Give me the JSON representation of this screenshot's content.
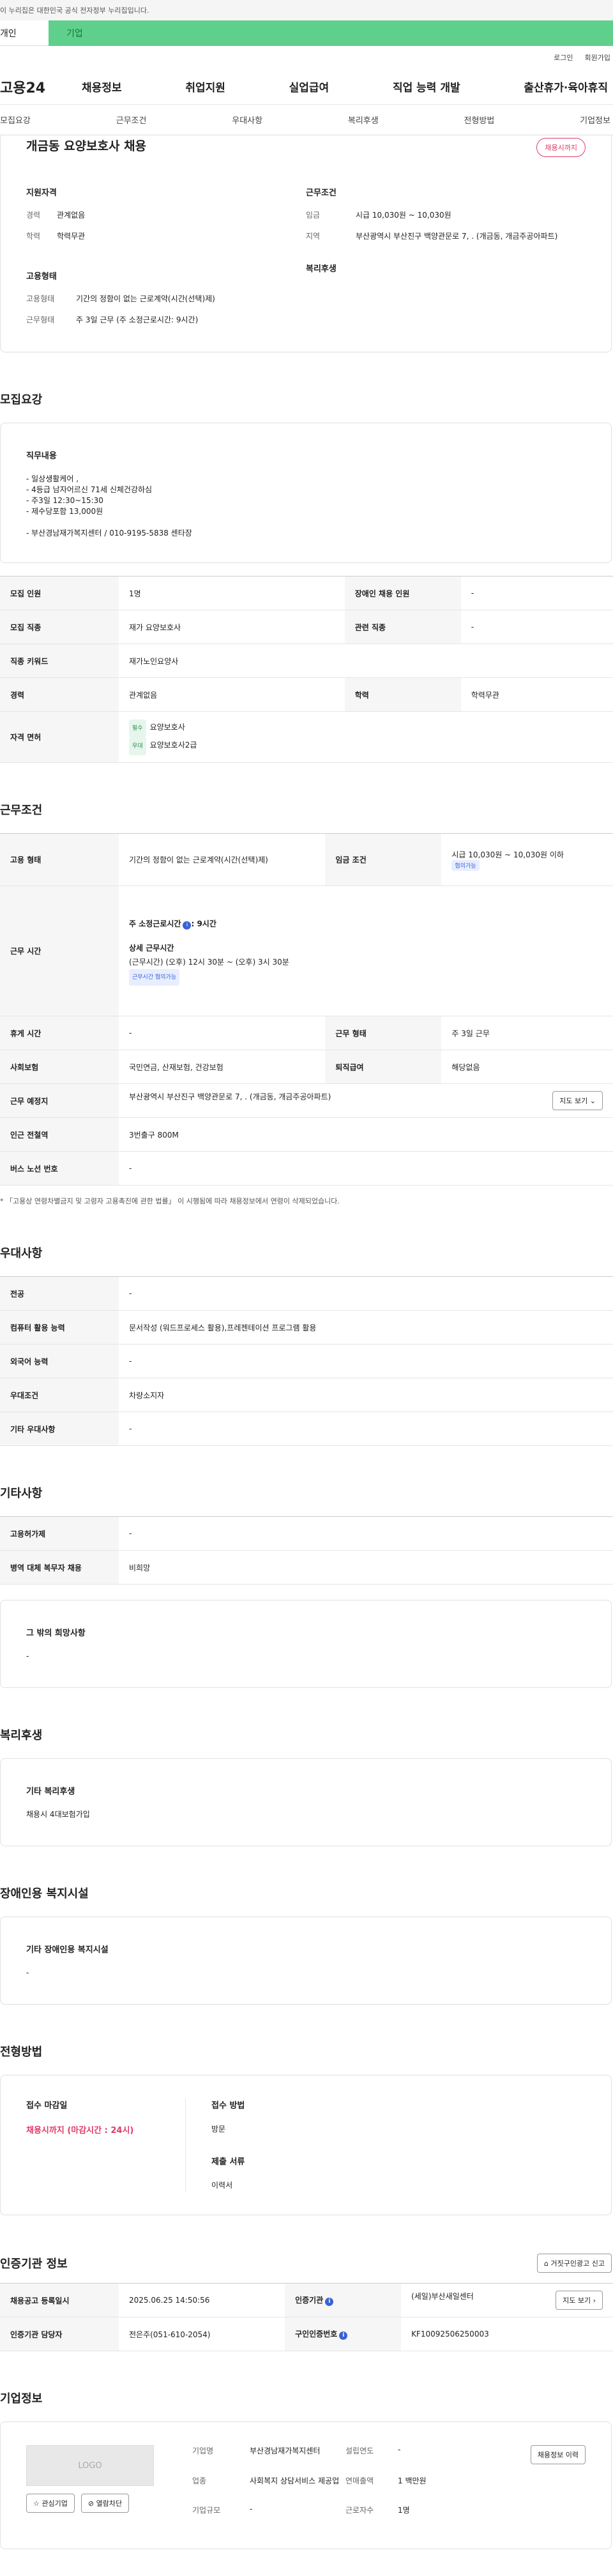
{
  "banner": "이 누리집은 대한민국 공식 전자정부 누리집입니다.",
  "user_tabs": [
    "개인",
    "기업"
  ],
  "util": [
    "로그인",
    "회원가입"
  ],
  "gnb": {
    "logo": "고용24",
    "menu": [
      "채용정보",
      "취업지원",
      "실업급여",
      "직업 능력 개발",
      "출산휴가·육아휴직"
    ]
  },
  "anchor": [
    "모집요강",
    "근무조건",
    "우대사항",
    "복리후생",
    "전형방법",
    "기업정보"
  ],
  "summary": {
    "title": "개금동 요양보호사 채용",
    "badge": "채용시까지",
    "qual_title": "지원자격",
    "qual": [
      {
        "k": "경력",
        "v": "관계없음"
      },
      {
        "k": "학력",
        "v": "학력무관"
      }
    ],
    "cond_title": "근무조건",
    "cond": [
      {
        "k": "임금",
        "v": "시급 10,030원 ~ 10,030원"
      },
      {
        "k": "지역",
        "v": "부산광역시 부산진구 백양관문로 7, . (개금동, 개금주공아파트)"
      }
    ],
    "emp_title": "고용형태",
    "emp": [
      {
        "k": "고용형태",
        "v": "기간의 정함이 없는 근로계약(시간(선택)제)"
      },
      {
        "k": "근무형태",
        "v": "주 3일 근무 (주 소정근로시간: 9시간)"
      }
    ],
    "welfare_title": "복리후생"
  },
  "recruit": {
    "title": "모집요강",
    "job_title": "직무내용",
    "job_desc": "- 일상생활케어 ,\n- 4등급 남자어르신 71세 신체건강하심\n- 주3일 12:30~15:30\n- 제수당포함 13,000원\n\n- 부산경남재가복지센터 / 010-9195-5838 센타장",
    "rows": {
      "count_k": "모집 인원",
      "count_v": "1명",
      "disab_k": "장애인 채용 인원",
      "disab_v": "-",
      "job_k": "모집 직종",
      "job_v": "재가 요양보호사",
      "rel_k": "관련 직종",
      "rel_v": "-",
      "kw_k": "직종 키워드",
      "kw_v": "재가노인요양사",
      "exp_k": "경력",
      "exp_v": "관계없음",
      "edu_k": "학력",
      "edu_v": "학력무관",
      "lic_k": "자격 면허",
      "lic_tag1": "필수",
      "lic_v1": "요양보호사",
      "lic_tag2": "우대",
      "lic_v2": "요양보호사2급"
    }
  },
  "work": {
    "title": "근무조건",
    "emp_k": "고용 형태",
    "emp_v": "기간의 정함이 없는 근로계약(시간(선택)제)",
    "wage_k": "임금 조건",
    "wage_v": "시급 10,030원 ~ 10,030원 이하",
    "wage_tag": "협의가능",
    "time_k": "근무 시간",
    "time_week": "주 소정근로시간",
    "time_week_v": ": 9시간",
    "time_detail_title": "상세 근무시간",
    "time_detail": "(근무시간) (오후) 12시 30분 ~ (오후) 3시 30분",
    "time_tag": "근무시간 협의가능",
    "rest_k": "휴게 시간",
    "rest_v": "-",
    "form_k": "근무 형태",
    "form_v": "주 3일 근무",
    "ins_k": "사회보험",
    "ins_v": "국민연금, 산재보험, 건강보험",
    "sev_k": "퇴직급여",
    "sev_v": "해당없음",
    "loc_k": "근무 예정지",
    "loc_v": "부산광역시 부산진구 백양관문로 7, . (개금동, 개금주공아파트)",
    "map_btn": "지도 보기",
    "sub_k": "인근 전철역",
    "sub_v": "3번출구 800M",
    "bus_k": "버스 노선 번호",
    "bus_v": "-",
    "note": "* 「고용상 연령차별금지 및 고령자 고용촉진에 관한 법률」 이 시행됨에 따라 채용정보에서 연령이 삭제되었습니다."
  },
  "pref": {
    "title": "우대사항",
    "rows": [
      {
        "k": "전공",
        "v": "-"
      },
      {
        "k": "컴퓨터 활용 능력",
        "v": "문서작성 (워드프로세스 활용),프레젠테이션 프로그램 활용"
      },
      {
        "k": "외국어 능력",
        "v": "-"
      },
      {
        "k": "우대조건",
        "v": "차량소지자"
      },
      {
        "k": "기타 우대사항",
        "v": "-"
      }
    ]
  },
  "etc": {
    "title": "기타사항",
    "rows": [
      {
        "k": "고용허가제",
        "v": "-"
      },
      {
        "k": "병역 대체 복무자 채용",
        "v": "비희망"
      }
    ],
    "other_title": "그 밖의 희망사항",
    "other_v": "-"
  },
  "welfare": {
    "title": "복리후생",
    "box_title": "기타 복리후생",
    "box_v": "채용시 4대보험가입"
  },
  "disab": {
    "title": "장애인용 복지시설",
    "box_title": "기타 장애인용 복지시설",
    "box_v": "-"
  },
  "apply": {
    "title": "전형방법",
    "deadline_k": "접수 마감일",
    "deadline_v": "채용시까지 (마감시간 : 24시)",
    "method_k": "접수 방법",
    "method_v": "방문",
    "docs_k": "제출 서류",
    "docs_v": "이력서"
  },
  "cert": {
    "title": "인증기관 정보",
    "report_btn": "거짓구인광고 신고",
    "reg_k": "채용공고 등록일시",
    "reg_v": "2025.06.25 14:50:56",
    "org_k": "인증기관",
    "org_v": "(세일)부산새일센터",
    "map_btn": "지도 보기",
    "mgr_k": "인증기관 담당자",
    "mgr_v": "전은주(051-610-2054)",
    "num_k": "구인인증번호",
    "num_v": "KF10092506250003"
  },
  "company": {
    "title": "기업정보",
    "logo": "LOGO",
    "fav_btn": "관심기업",
    "block_btn": "열람차단",
    "info_btn": "채용정보 이력",
    "name_k": "기업명",
    "name_v": "부산경남재가복지센터",
    "ind_k": "업종",
    "ind_v": "사회복지 상담서비스 제공업",
    "size_k": "기업규모",
    "size_v": "-",
    "est_k": "설립연도",
    "est_v": "-",
    "sales_k": "연매출액",
    "sales_v": "1 백만원",
    "emp_k": "근로자수",
    "emp_v": "1명"
  }
}
